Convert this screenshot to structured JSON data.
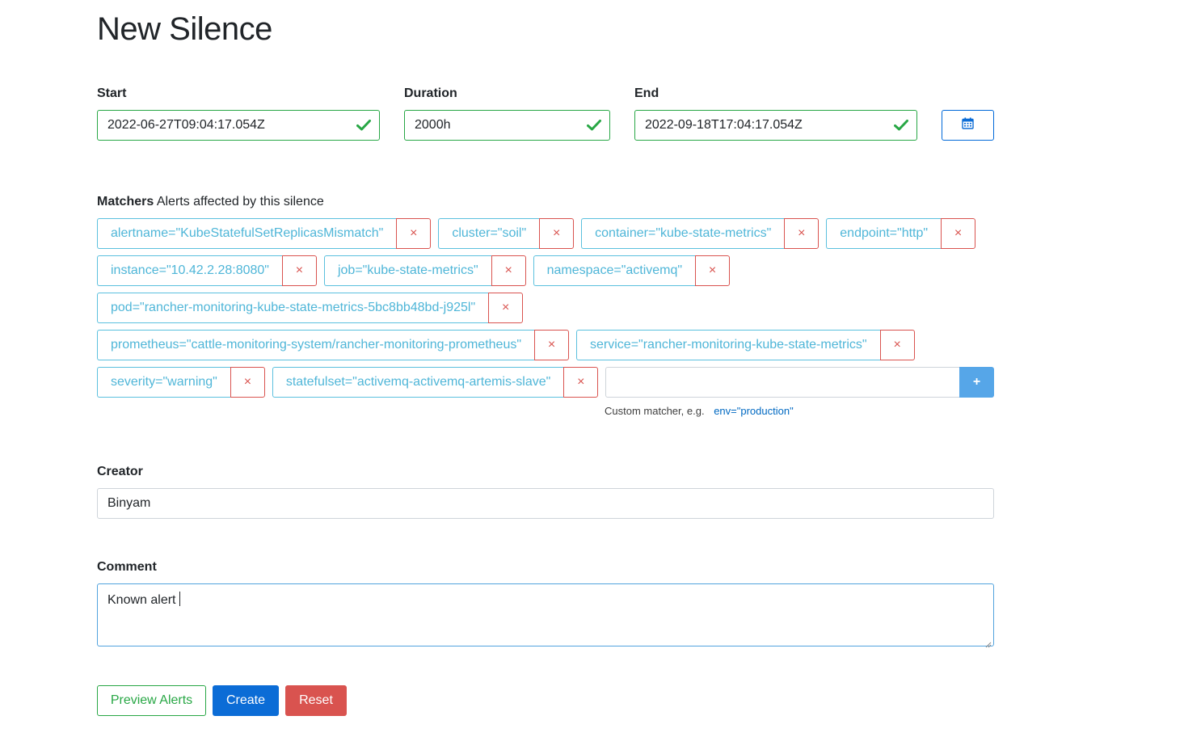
{
  "page": {
    "title": "New Silence"
  },
  "start": {
    "label": "Start",
    "value": "2022-06-27T09:04:17.054Z"
  },
  "duration": {
    "label": "Duration",
    "value": "2000h"
  },
  "end": {
    "label": "End",
    "value": "2022-09-18T17:04:17.054Z"
  },
  "calendar_button": {
    "icon": "calendar-icon"
  },
  "matchers": {
    "label": "Matchers",
    "description": "Alerts affected by this silence",
    "remove_symbol": "×",
    "items": [
      "alertname=\"KubeStatefulSetReplicasMismatch\"",
      "cluster=\"soil\"",
      "container=\"kube-state-metrics\"",
      "endpoint=\"http\"",
      "instance=\"10.42.2.28:8080\"",
      "job=\"kube-state-metrics\"",
      "namespace=\"activemq\"",
      "pod=\"rancher-monitoring-kube-state-metrics-5bc8bb48bd-j925l\"",
      "prometheus=\"cattle-monitoring-system/rancher-monitoring-prometheus\"",
      "service=\"rancher-monitoring-kube-state-metrics\"",
      "severity=\"warning\"",
      "statefulset=\"activemq-activemq-artemis-slave\""
    ],
    "custom": {
      "value": "",
      "add_label": "+",
      "hint": "Custom matcher, e.g.",
      "example": "env=\"production\""
    }
  },
  "creator": {
    "label": "Creator",
    "value": "Binyam"
  },
  "comment": {
    "label": "Comment",
    "value": "Known alert"
  },
  "buttons": {
    "preview": "Preview Alerts",
    "create": "Create",
    "reset": "Reset"
  },
  "colors": {
    "success": "#28a745",
    "info": "#5bc0de",
    "danger": "#d9534f",
    "primary": "#0b6cd6",
    "add_button": "#56a6e8"
  }
}
